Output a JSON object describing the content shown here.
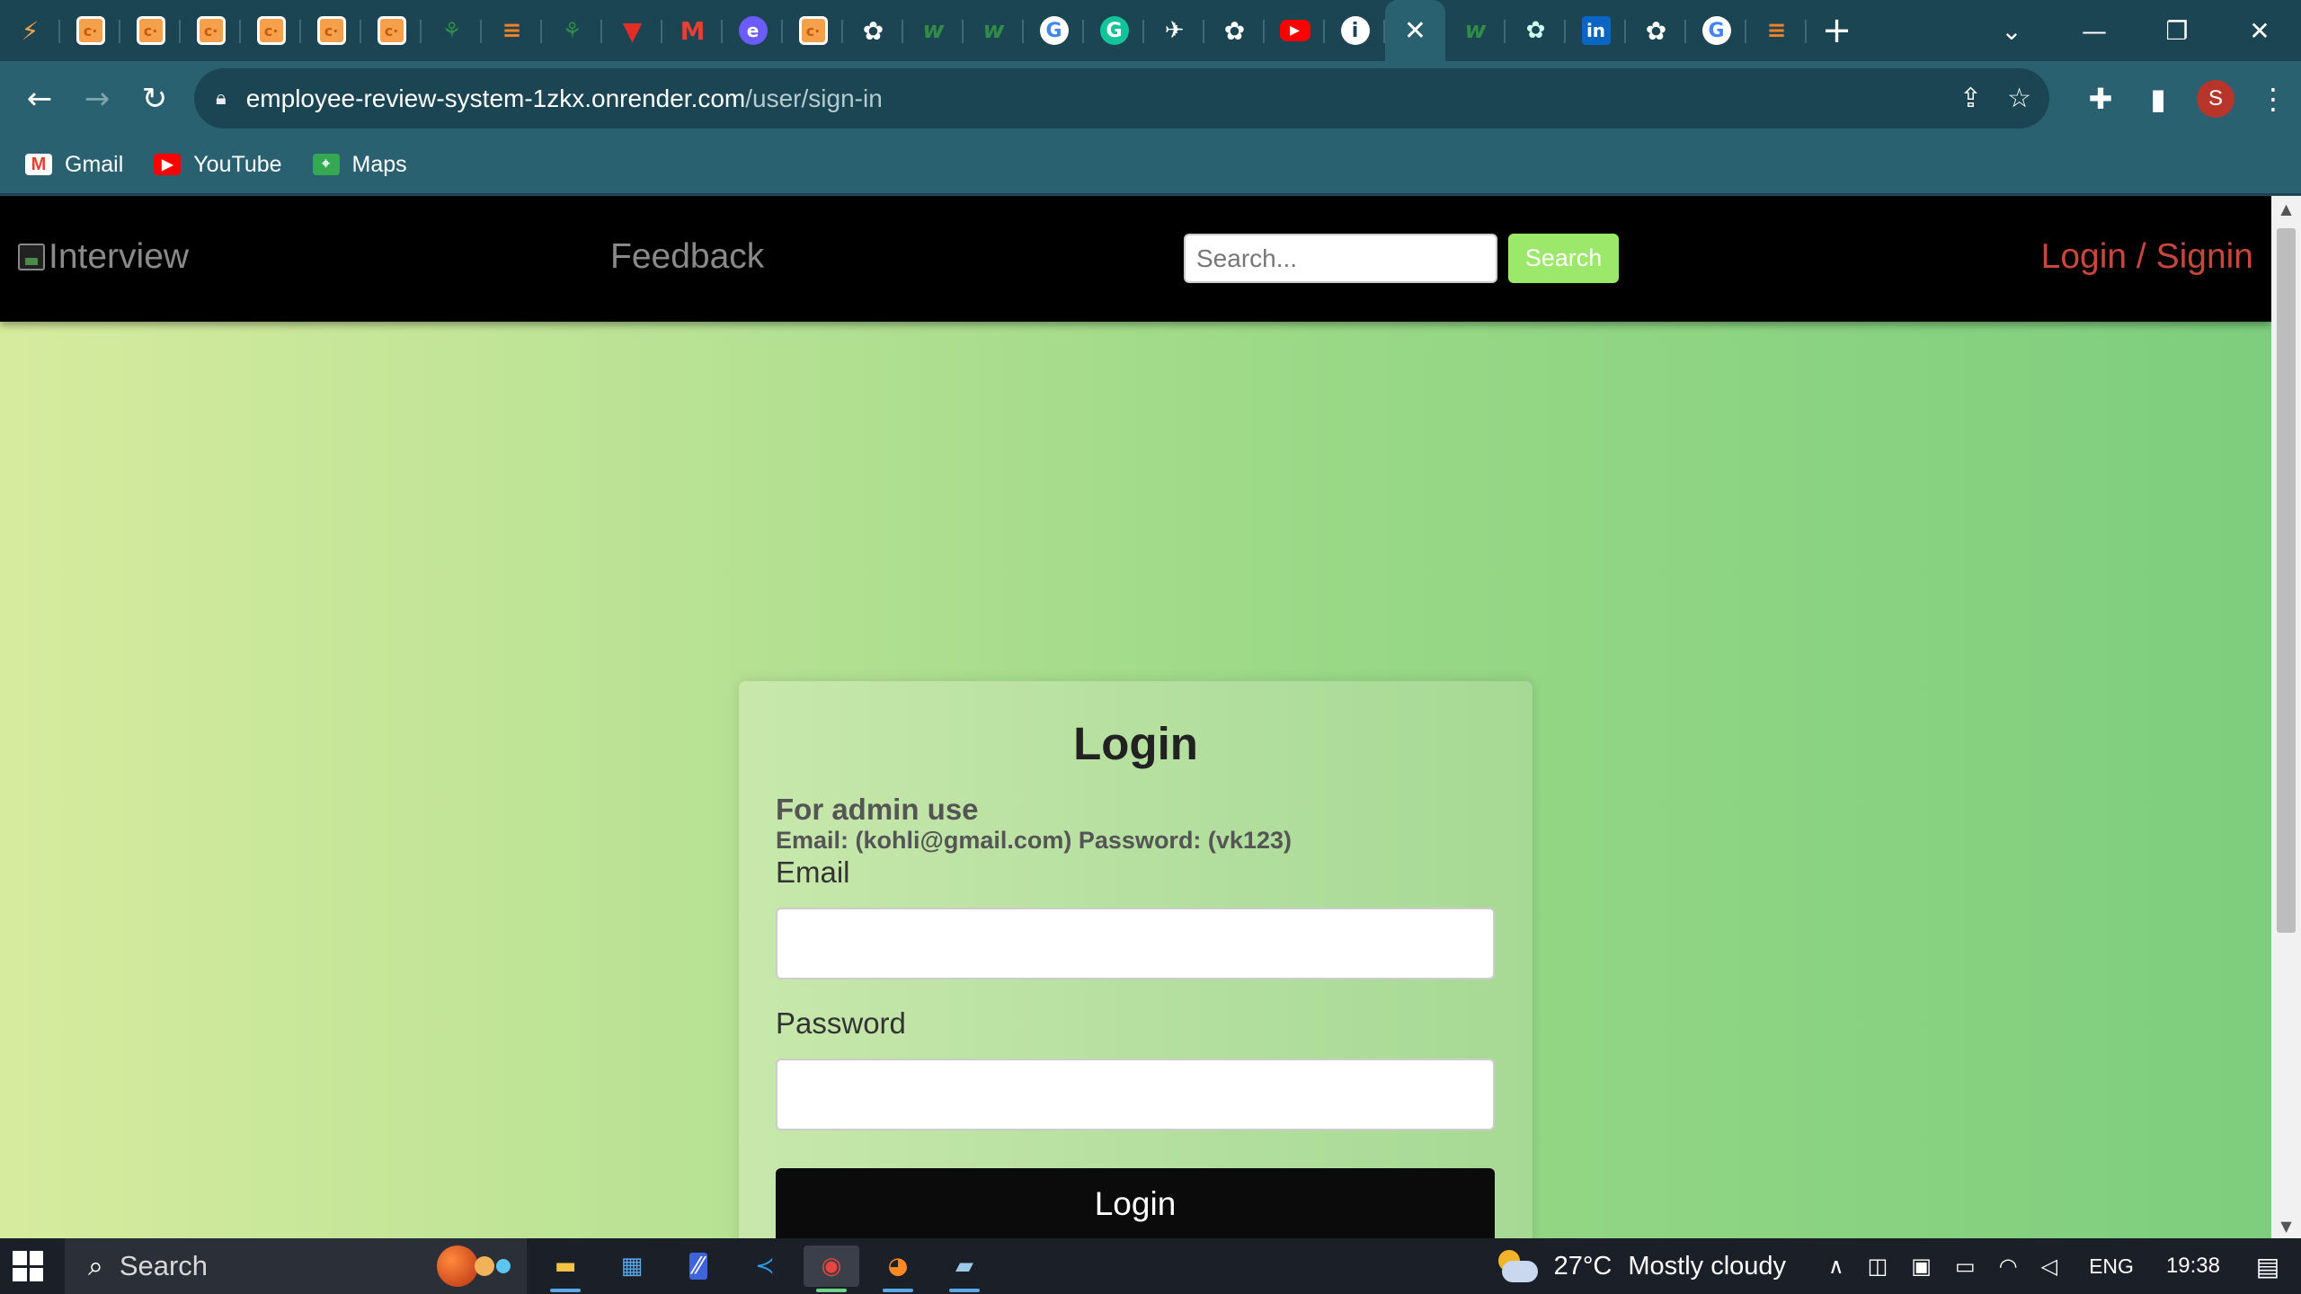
{
  "browser": {
    "tabs": [
      {
        "icon": "codeforces-icon",
        "glyph": "⚡",
        "cls": "first"
      },
      {
        "icon": "coding-ninjas-icon",
        "glyph": "c·",
        "cls": "cn"
      },
      {
        "icon": "coding-ninjas-icon",
        "glyph": "c·",
        "cls": "cn"
      },
      {
        "icon": "coding-ninjas-icon",
        "glyph": "c·",
        "cls": "cn"
      },
      {
        "icon": "coding-ninjas-icon",
        "glyph": "c·",
        "cls": "cn"
      },
      {
        "icon": "coding-ninjas-icon",
        "glyph": "c·",
        "cls": "cn"
      },
      {
        "icon": "coding-ninjas-icon",
        "glyph": "c·",
        "cls": "cn"
      },
      {
        "icon": "geeksforgeeks-icon",
        "glyph": "⚘",
        "cls": "gfg"
      },
      {
        "icon": "stackoverflow-icon",
        "glyph": "≡",
        "cls": "so"
      },
      {
        "icon": "geeksforgeeks-icon",
        "glyph": "⚘",
        "cls": "gfg"
      },
      {
        "icon": "vite-icon",
        "glyph": "▼",
        "cls": "vt"
      },
      {
        "icon": "gmail-icon",
        "glyph": "M",
        "cls": "gm"
      },
      {
        "icon": "edge-icon",
        "glyph": "e",
        "cls": "ed"
      },
      {
        "icon": "coding-ninjas-icon",
        "glyph": "c·",
        "cls": "cn"
      },
      {
        "icon": "chatgpt-icon",
        "glyph": "✿",
        "cls": "ch"
      },
      {
        "icon": "w3-icon",
        "glyph": "w",
        "cls": "w"
      },
      {
        "icon": "w3-icon",
        "glyph": "w",
        "cls": "w"
      },
      {
        "icon": "google-icon",
        "glyph": "G",
        "cls": "g"
      },
      {
        "icon": "grammarly-icon",
        "glyph": "G",
        "cls": "gr"
      },
      {
        "icon": "runner-icon",
        "glyph": "✈",
        "cls": "run"
      },
      {
        "icon": "chatgpt-icon",
        "glyph": "✿",
        "cls": "ch"
      },
      {
        "icon": "youtube-icon",
        "glyph": "▶",
        "cls": "yt"
      },
      {
        "icon": "info-icon",
        "glyph": "i",
        "cls": "info"
      }
    ],
    "tabs_after": [
      {
        "icon": "w3-icon",
        "glyph": "w",
        "cls": "w"
      },
      {
        "icon": "chatgpt-icon",
        "glyph": "✿",
        "cls": "gpt"
      },
      {
        "icon": "linkedin-icon",
        "glyph": "in",
        "cls": "li"
      },
      {
        "icon": "chatgpt-icon",
        "glyph": "✿",
        "cls": "ch"
      },
      {
        "icon": "google-icon",
        "glyph": "G",
        "cls": "g"
      },
      {
        "icon": "stackoverflow-icon",
        "glyph": "≡",
        "cls": "so"
      }
    ],
    "active_tab_close": "✕",
    "new_tab": "+",
    "url_host": "employee-review-system-1zkx.onrender.com",
    "url_path": "/user/sign-in",
    "profile_initial": "S",
    "bookmarks": [
      {
        "label": "Gmail",
        "icon": "gmail-icon"
      },
      {
        "label": "YouTube",
        "icon": "youtube-icon"
      },
      {
        "label": "Maps",
        "icon": "maps-icon"
      }
    ]
  },
  "site": {
    "logo_alt": "Interview",
    "nav_feedback": "Feedback",
    "search_placeholder": "Search...",
    "search_button": "Search",
    "nav_login": "Login / Signin"
  },
  "login_card": {
    "title": "Login",
    "admin_title": "For admin use",
    "admin_credentials": "Email: (kohli@gmail.com) Password: (vk123)",
    "email_label": "Email",
    "email_value": "",
    "password_label": "Password",
    "password_value": "",
    "submit_label": "Login"
  },
  "taskbar": {
    "search_label": "Search",
    "weather_temp": "27°C",
    "weather_desc": "Mostly cloudy",
    "language": "ENG",
    "time": "19:38"
  },
  "colors": {
    "browser_frame": "#1b4552",
    "toolbar": "#2a6170",
    "site_nav": "#000000",
    "login_link": "#c9463d",
    "search_button": "#9be86a",
    "page_gradient_start": "#d6eb9e",
    "page_gradient_end": "#7dce7e"
  }
}
